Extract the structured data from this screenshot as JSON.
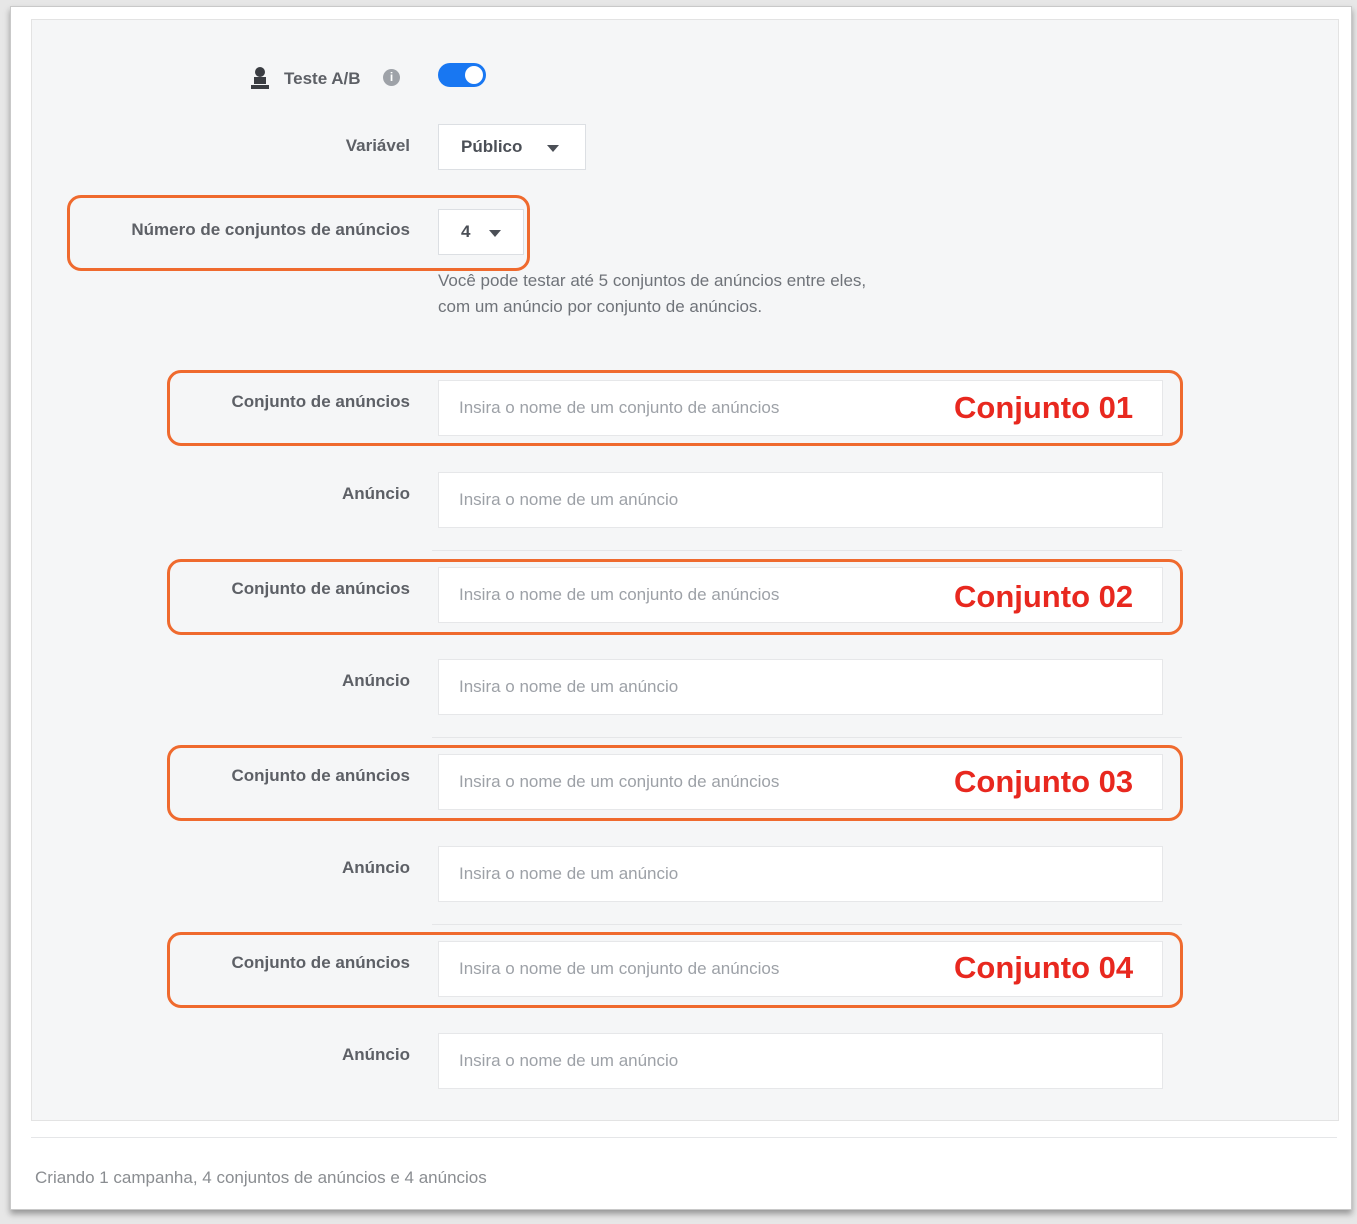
{
  "ab_test": {
    "label": "Teste A/B",
    "user_icon": "person-icon",
    "info_icon": "info-icon",
    "info_glyph": "i",
    "toggle_on": true,
    "toggle_color": "#1877f2"
  },
  "variable": {
    "label": "Variável",
    "value": "Público"
  },
  "count": {
    "label": "Número de conjuntos de anúncios",
    "value": "4",
    "helper": "Você pode testar até 5 conjuntos de anúncios entre eles, com um anúncio por conjunto de anúncios."
  },
  "sets": [
    {
      "set_label": "Conjunto de anúncios",
      "set_placeholder": "Insira o nome de um conjunto de anúncios",
      "tag": "Conjunto 01",
      "ad_label": "Anúncio",
      "ad_placeholder": "Insira o nome de um anúncio"
    },
    {
      "set_label": "Conjunto de anúncios",
      "set_placeholder": "Insira o nome de um conjunto de anúncios",
      "tag": "Conjunto 02",
      "ad_label": "Anúncio",
      "ad_placeholder": "Insira o nome de um anúncio"
    },
    {
      "set_label": "Conjunto de anúncios",
      "set_placeholder": "Insira o nome de um conjunto de anúncios",
      "tag": "Conjunto 03",
      "ad_label": "Anúncio",
      "ad_placeholder": "Insira o nome de um anúncio"
    },
    {
      "set_label": "Conjunto de anúncios",
      "set_placeholder": "Insira o nome de um conjunto de anúncios",
      "tag": "Conjunto 04",
      "ad_label": "Anúncio",
      "ad_placeholder": "Insira o nome de um anúncio"
    }
  ],
  "footer": {
    "summary": "Criando 1 campanha, 4 conjuntos de anúncios e 4 anúncios"
  },
  "colors": {
    "highlight": "#ef6a2e",
    "tag_text": "#e8281f"
  }
}
